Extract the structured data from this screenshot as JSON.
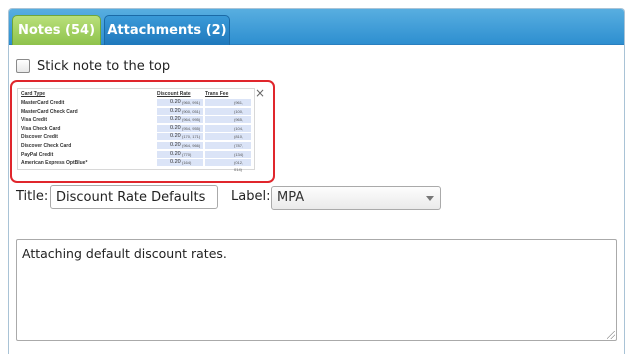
{
  "tabs": [
    {
      "label": "Notes (54)",
      "active": true
    },
    {
      "label": "Attachments (2)",
      "active": false
    }
  ],
  "stick_note": {
    "label": "Stick note to the top",
    "checked": false
  },
  "attachment_preview": {
    "close_symbol": "×",
    "headers": {
      "card_type": "Card Type",
      "discount_rate": "Discount Rate",
      "trans_fee": "Trans Fee"
    },
    "rows": [
      {
        "card": "MasterCard Credit",
        "rate": "0.20",
        "rate_code": "(960, 991)",
        "fee_code": "(961, 992)"
      },
      {
        "card": "MasterCard Check Card",
        "rate": "0.20",
        "rate_code": "(900, 051)",
        "fee_code": "(100, 131)"
      },
      {
        "card": "Visa Credit",
        "rate": "0.20",
        "rate_code": "(964, 995)",
        "fee_code": "(965, 996)"
      },
      {
        "card": "Visa Check Card",
        "rate": "0.20",
        "rate_code": "(954, 955)",
        "fee_code": "(104, 135)"
      },
      {
        "card": "Discover Credit",
        "rate": "0.20",
        "rate_code": "(170, 171)",
        "fee_code": "(810, 518)"
      },
      {
        "card": "Discover Check Card",
        "rate": "0.20",
        "rate_code": "(964, 966)",
        "fee_code": "(787, 788)"
      },
      {
        "card": "PayPal Credit",
        "rate": "0.20",
        "rate_code": "(770)",
        "fee_code": "(134)"
      },
      {
        "card": "American Express OptBlue*",
        "rate": "0.20",
        "rate_code": "(164)",
        "fee_code": "(012, 014)"
      }
    ]
  },
  "form": {
    "title_label": "Title:",
    "title_value": "Discount Rate Defaults",
    "label_label": "Label:",
    "label_value": "MPA"
  },
  "note_text": "Attaching default discount rates.",
  "colors": {
    "active_tab": "#8ec24c",
    "tab_bar": "#2e8fd0",
    "highlight_border": "#e0262c"
  }
}
